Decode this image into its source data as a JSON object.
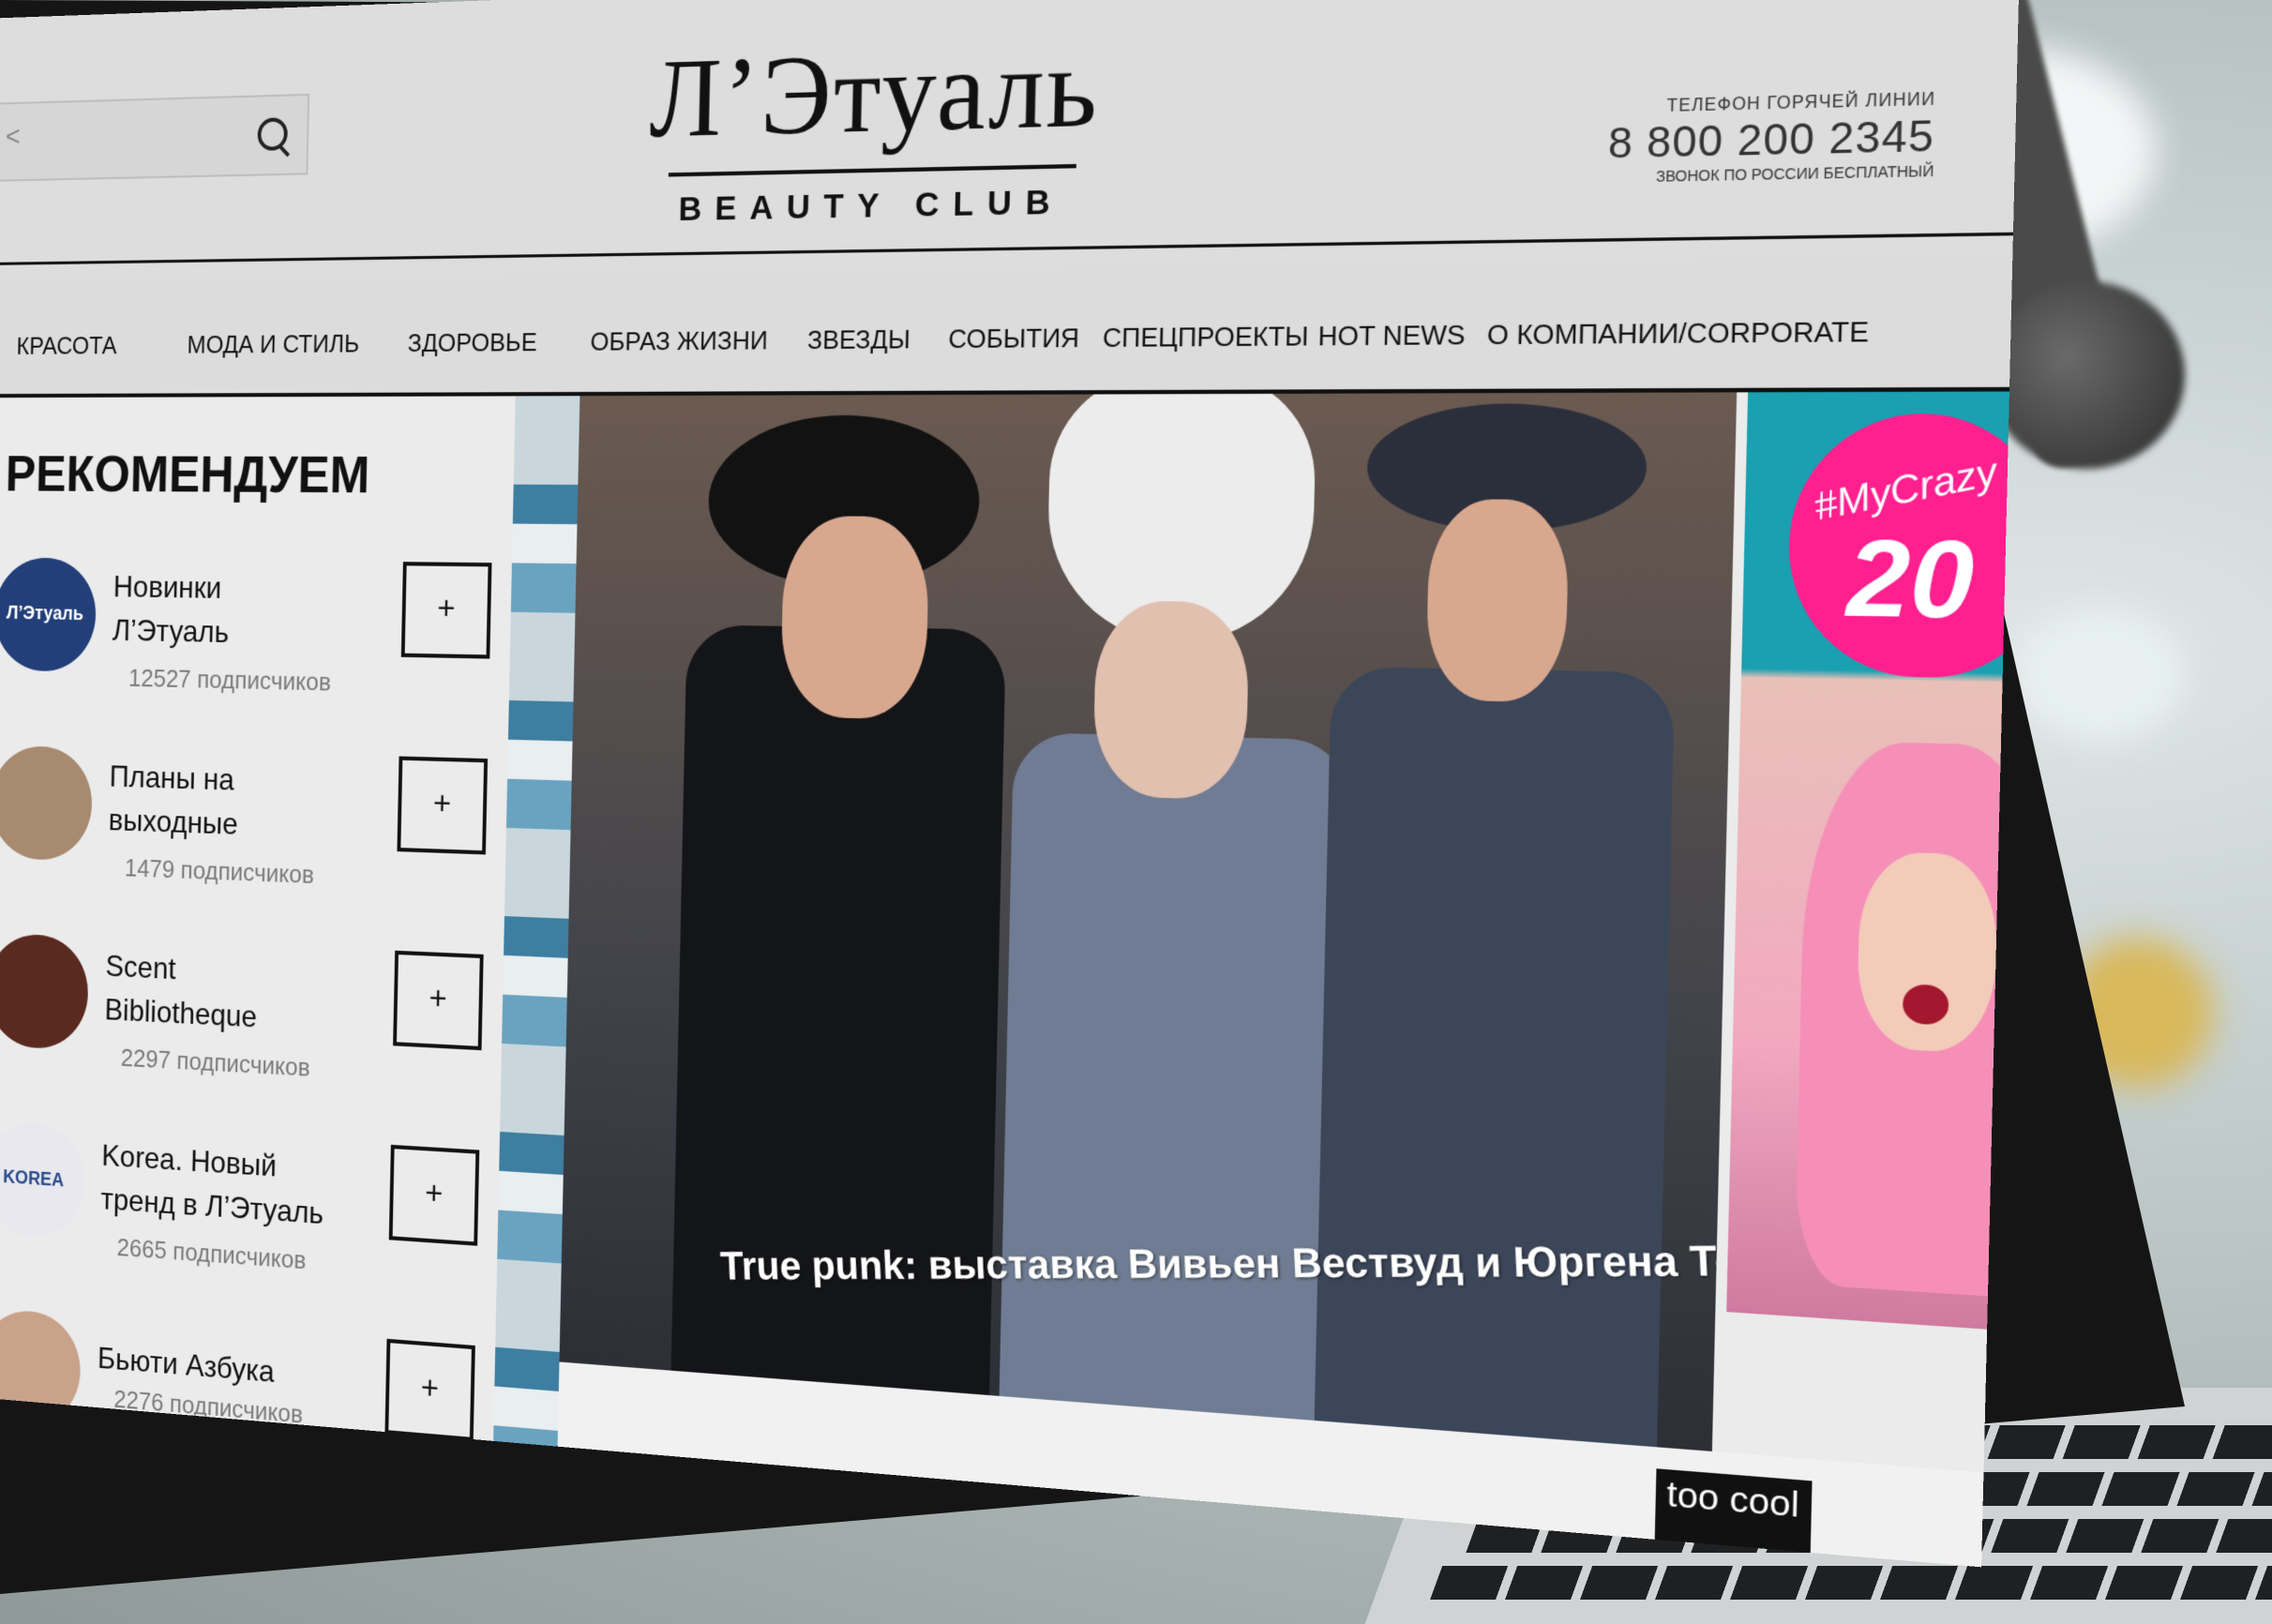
{
  "header": {
    "search_placeholder": "<",
    "logo_word": "Л’Этуаль",
    "logo_sub": "BEAUTY CLUB",
    "hotline_label": "ТЕЛЕФОН ГОРЯЧЕЙ ЛИНИИ",
    "hotline_number": "8 800 200 2345",
    "hotline_note": "ЗВОНОК ПО РОССИИ БЕСПЛАТНЫЙ"
  },
  "nav": [
    {
      "label": "КРАСОТА"
    },
    {
      "label": "МОДА И СТИЛЬ"
    },
    {
      "label": "ЗДОРОВЬЕ"
    },
    {
      "label": "ОБРАЗ ЖИЗНИ"
    },
    {
      "label": "ЗВЕЗДЫ"
    },
    {
      "label": "СОБЫТИЯ"
    },
    {
      "label": "СПЕЦПРОЕКТЫ"
    },
    {
      "label": "HOT NEWS"
    },
    {
      "label": "О КОМПАНИИ/CORPORATE"
    }
  ],
  "recommend": {
    "title": "РЕКОМЕНДУЕМ",
    "items": [
      {
        "name": "Новинки Л’Этуаль",
        "subs": "12527 подписчиков",
        "avatar_text": "Л’Этуаль",
        "add": "+"
      },
      {
        "name": "Планы на выходные",
        "subs": "1479 подписчиков",
        "avatar_text": "",
        "add": "+"
      },
      {
        "name": "Scent Bibliotheque",
        "subs": "2297 подписчиков",
        "avatar_text": "",
        "add": "+"
      },
      {
        "name": "Korea. Новый тренд в Л’Этуаль",
        "subs": "2665 подписчиков",
        "avatar_text": "KOREA",
        "add": "+"
      },
      {
        "name": "Бьюти Азбука",
        "subs": "2276 подписчиков",
        "avatar_text": "",
        "add": "+"
      }
    ]
  },
  "hero": {
    "caption": "True punk: выставка Вивьен Вествуд и Юргена Теллера"
  },
  "promo": {
    "hashtag": "#MyCrazy",
    "number": "20"
  },
  "badge": {
    "text": "too cool"
  },
  "colors": {
    "promo_pink": "#ff1f8f",
    "header_bg": "#dddddd",
    "text": "#111111"
  }
}
